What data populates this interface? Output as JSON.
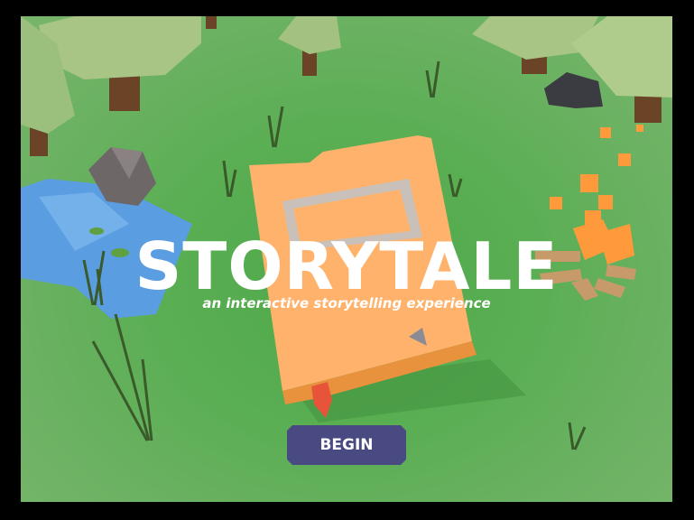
{
  "game": {
    "title": "STORYTALE",
    "subtitle": "an interactive storytelling experience",
    "begin_label": "BEGIN"
  },
  "colors": {
    "grass": "#5aae53",
    "book": "#ffb26b",
    "button": "#4a4a82",
    "water": "#5a9de0",
    "fire": "#ff9a3c",
    "bookmark": "#e8543a"
  }
}
